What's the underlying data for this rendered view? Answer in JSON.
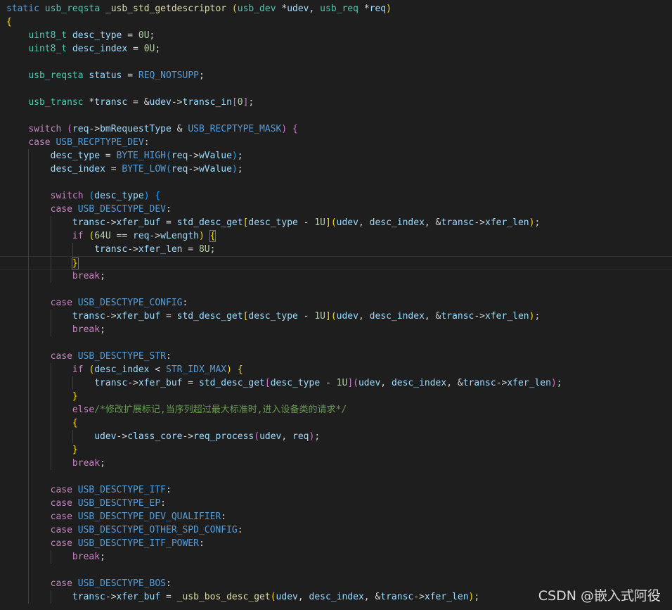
{
  "colors": {
    "background": "#1e1e1e",
    "keyword": "#569cd6",
    "control": "#c586c0",
    "type": "#4ec9b0",
    "function": "#dcdcaa",
    "variable": "#9cdcfe",
    "number": "#b5cea8",
    "comment": "#6a9955",
    "plain": "#d4d4d4",
    "brace1": "#ffd700",
    "brace2": "#da70d6",
    "brace3": "#179fff"
  },
  "code_lines": [
    [
      [
        "static",
        "#569cd6"
      ],
      [
        " ",
        ""
      ],
      [
        "usb_reqsta",
        "#4ec9b0"
      ],
      [
        " ",
        ""
      ],
      [
        "_usb_std_getdescriptor",
        "#dcdcaa"
      ],
      [
        " ",
        ""
      ],
      [
        "(",
        "#ffd700"
      ],
      [
        "usb_dev",
        "#4ec9b0"
      ],
      [
        " *",
        ""
      ],
      [
        "udev",
        "#9cdcfe"
      ],
      [
        ", ",
        ""
      ],
      [
        "usb_req",
        "#4ec9b0"
      ],
      [
        " *",
        ""
      ],
      [
        "req",
        "#9cdcfe"
      ],
      [
        ")",
        "#ffd700"
      ]
    ],
    [
      [
        "{",
        "#ffd700"
      ]
    ],
    [
      [
        "    ",
        ""
      ],
      [
        "uint8_t",
        "#4ec9b0"
      ],
      [
        " ",
        ""
      ],
      [
        "desc_type",
        "#9cdcfe"
      ],
      [
        " = ",
        ""
      ],
      [
        "0U",
        "#b5cea8"
      ],
      [
        ";",
        ""
      ]
    ],
    [
      [
        "    ",
        ""
      ],
      [
        "uint8_t",
        "#4ec9b0"
      ],
      [
        " ",
        ""
      ],
      [
        "desc_index",
        "#9cdcfe"
      ],
      [
        " = ",
        ""
      ],
      [
        "0U",
        "#b5cea8"
      ],
      [
        ";",
        ""
      ]
    ],
    [],
    [
      [
        "    ",
        ""
      ],
      [
        "usb_reqsta",
        "#4ec9b0"
      ],
      [
        " ",
        ""
      ],
      [
        "status",
        "#9cdcfe"
      ],
      [
        " = ",
        ""
      ],
      [
        "REQ_NOTSUPP",
        "#569cd6"
      ],
      [
        ";",
        ""
      ]
    ],
    [],
    [
      [
        "    ",
        ""
      ],
      [
        "usb_transc",
        "#4ec9b0"
      ],
      [
        " *",
        ""
      ],
      [
        "transc",
        "#9cdcfe"
      ],
      [
        " = &",
        ""
      ],
      [
        "udev",
        "#9cdcfe"
      ],
      [
        "->",
        ""
      ],
      [
        "transc_in",
        "#9cdcfe"
      ],
      [
        "[",
        "#da70d6"
      ],
      [
        "0",
        "#b5cea8"
      ],
      [
        "]",
        "#da70d6"
      ],
      [
        ";",
        ""
      ]
    ],
    [],
    [
      [
        "    ",
        ""
      ],
      [
        "switch",
        "#c586c0"
      ],
      [
        " ",
        ""
      ],
      [
        "(",
        "#da70d6"
      ],
      [
        "req",
        "#9cdcfe"
      ],
      [
        "->",
        ""
      ],
      [
        "bmRequestType",
        "#9cdcfe"
      ],
      [
        " & ",
        ""
      ],
      [
        "USB_RECPTYPE_MASK",
        "#569cd6"
      ],
      [
        ")",
        "#da70d6"
      ],
      [
        " ",
        ""
      ],
      [
        "{",
        "#da70d6"
      ]
    ],
    [
      [
        "    ",
        ""
      ],
      [
        "case",
        "#c586c0"
      ],
      [
        " ",
        ""
      ],
      [
        "USB_RECPTYPE_DEV",
        "#569cd6"
      ],
      [
        ":",
        ""
      ]
    ],
    [
      [
        "        ",
        ""
      ],
      [
        "desc_type",
        "#9cdcfe"
      ],
      [
        " = ",
        ""
      ],
      [
        "BYTE_HIGH",
        "#569cd6"
      ],
      [
        "(",
        "#179fff"
      ],
      [
        "req",
        "#9cdcfe"
      ],
      [
        "->",
        ""
      ],
      [
        "wValue",
        "#9cdcfe"
      ],
      [
        ")",
        "#179fff"
      ],
      [
        ";",
        ""
      ]
    ],
    [
      [
        "        ",
        ""
      ],
      [
        "desc_index",
        "#9cdcfe"
      ],
      [
        " = ",
        ""
      ],
      [
        "BYTE_LOW",
        "#569cd6"
      ],
      [
        "(",
        "#179fff"
      ],
      [
        "req",
        "#9cdcfe"
      ],
      [
        "->",
        ""
      ],
      [
        "wValue",
        "#9cdcfe"
      ],
      [
        ")",
        "#179fff"
      ],
      [
        ";",
        ""
      ]
    ],
    [],
    [
      [
        "        ",
        ""
      ],
      [
        "switch",
        "#c586c0"
      ],
      [
        " ",
        ""
      ],
      [
        "(",
        "#179fff"
      ],
      [
        "desc_type",
        "#9cdcfe"
      ],
      [
        ")",
        "#179fff"
      ],
      [
        " ",
        ""
      ],
      [
        "{",
        "#179fff"
      ]
    ],
    [
      [
        "        ",
        ""
      ],
      [
        "case",
        "#c586c0"
      ],
      [
        " ",
        ""
      ],
      [
        "USB_DESCTYPE_DEV",
        "#569cd6"
      ],
      [
        ":",
        ""
      ]
    ],
    [
      [
        "            ",
        ""
      ],
      [
        "transc",
        "#9cdcfe"
      ],
      [
        "->",
        ""
      ],
      [
        "xfer_buf",
        "#9cdcfe"
      ],
      [
        " = ",
        ""
      ],
      [
        "std_desc_get",
        "#9cdcfe"
      ],
      [
        "[",
        "#ffd700"
      ],
      [
        "desc_type",
        "#9cdcfe"
      ],
      [
        " - ",
        ""
      ],
      [
        "1U",
        "#b5cea8"
      ],
      [
        "]",
        "#ffd700"
      ],
      [
        "(",
        "#ffd700"
      ],
      [
        "udev",
        "#9cdcfe"
      ],
      [
        ", ",
        ""
      ],
      [
        "desc_index",
        "#9cdcfe"
      ],
      [
        ", &",
        ""
      ],
      [
        "transc",
        "#9cdcfe"
      ],
      [
        "->",
        ""
      ],
      [
        "xfer_len",
        "#9cdcfe"
      ],
      [
        ")",
        "#ffd700"
      ],
      [
        ";",
        ""
      ]
    ],
    [
      [
        "            ",
        ""
      ],
      [
        "if",
        "#c586c0"
      ],
      [
        " ",
        ""
      ],
      [
        "(",
        "#ffd700"
      ],
      [
        "64U",
        "#b5cea8"
      ],
      [
        " == ",
        ""
      ],
      [
        "req",
        "#9cdcfe"
      ],
      [
        "->",
        ""
      ],
      [
        "wLength",
        "#9cdcfe"
      ],
      [
        ")",
        "#ffd700"
      ],
      [
        " ",
        ""
      ],
      [
        "{",
        "#ffd700",
        "bm"
      ]
    ],
    [
      [
        "                ",
        ""
      ],
      [
        "transc",
        "#9cdcfe"
      ],
      [
        "->",
        ""
      ],
      [
        "xfer_len",
        "#9cdcfe"
      ],
      [
        " = ",
        ""
      ],
      [
        "8U",
        "#b5cea8"
      ],
      [
        ";",
        ""
      ]
    ],
    [
      [
        "            ",
        ""
      ],
      [
        "}",
        "#ffd700",
        "bm"
      ]
    ],
    [
      [
        "            ",
        ""
      ],
      [
        "break",
        "#c586c0"
      ],
      [
        ";",
        ""
      ]
    ],
    [],
    [
      [
        "        ",
        ""
      ],
      [
        "case",
        "#c586c0"
      ],
      [
        " ",
        ""
      ],
      [
        "USB_DESCTYPE_CONFIG",
        "#569cd6"
      ],
      [
        ":",
        ""
      ]
    ],
    [
      [
        "            ",
        ""
      ],
      [
        "transc",
        "#9cdcfe"
      ],
      [
        "->",
        ""
      ],
      [
        "xfer_buf",
        "#9cdcfe"
      ],
      [
        " = ",
        ""
      ],
      [
        "std_desc_get",
        "#9cdcfe"
      ],
      [
        "[",
        "#ffd700"
      ],
      [
        "desc_type",
        "#9cdcfe"
      ],
      [
        " - ",
        ""
      ],
      [
        "1U",
        "#b5cea8"
      ],
      [
        "]",
        "#ffd700"
      ],
      [
        "(",
        "#ffd700"
      ],
      [
        "udev",
        "#9cdcfe"
      ],
      [
        ", ",
        ""
      ],
      [
        "desc_index",
        "#9cdcfe"
      ],
      [
        ", &",
        ""
      ],
      [
        "transc",
        "#9cdcfe"
      ],
      [
        "->",
        ""
      ],
      [
        "xfer_len",
        "#9cdcfe"
      ],
      [
        ")",
        "#ffd700"
      ],
      [
        ";",
        ""
      ]
    ],
    [
      [
        "            ",
        ""
      ],
      [
        "break",
        "#c586c0"
      ],
      [
        ";",
        ""
      ]
    ],
    [],
    [
      [
        "        ",
        ""
      ],
      [
        "case",
        "#c586c0"
      ],
      [
        " ",
        ""
      ],
      [
        "USB_DESCTYPE_STR",
        "#569cd6"
      ],
      [
        ":",
        ""
      ]
    ],
    [
      [
        "            ",
        ""
      ],
      [
        "if",
        "#c586c0"
      ],
      [
        " ",
        ""
      ],
      [
        "(",
        "#ffd700"
      ],
      [
        "desc_index",
        "#9cdcfe"
      ],
      [
        " < ",
        ""
      ],
      [
        "STR_IDX_MAX",
        "#569cd6"
      ],
      [
        ")",
        "#ffd700"
      ],
      [
        " ",
        ""
      ],
      [
        "{",
        "#ffd700"
      ]
    ],
    [
      [
        "                ",
        ""
      ],
      [
        "transc",
        "#9cdcfe"
      ],
      [
        "->",
        ""
      ],
      [
        "xfer_buf",
        "#9cdcfe"
      ],
      [
        " = ",
        ""
      ],
      [
        "std_desc_get",
        "#9cdcfe"
      ],
      [
        "[",
        "#da70d6"
      ],
      [
        "desc_type",
        "#9cdcfe"
      ],
      [
        " - ",
        ""
      ],
      [
        "1U",
        "#b5cea8"
      ],
      [
        "]",
        "#da70d6"
      ],
      [
        "(",
        "#da70d6"
      ],
      [
        "udev",
        "#9cdcfe"
      ],
      [
        ", ",
        ""
      ],
      [
        "desc_index",
        "#9cdcfe"
      ],
      [
        ", &",
        ""
      ],
      [
        "transc",
        "#9cdcfe"
      ],
      [
        "->",
        ""
      ],
      [
        "xfer_len",
        "#9cdcfe"
      ],
      [
        ")",
        "#da70d6"
      ],
      [
        ";",
        ""
      ]
    ],
    [
      [
        "            ",
        ""
      ],
      [
        "}",
        "#ffd700"
      ]
    ],
    [
      [
        "            ",
        ""
      ],
      [
        "else",
        "#c586c0"
      ],
      [
        "/*修改扩展标记,当序列超过最大标准时,进入设备类的请求*/",
        "#6a9955"
      ]
    ],
    [
      [
        "            ",
        ""
      ],
      [
        "{",
        "#ffd700"
      ]
    ],
    [
      [
        "                ",
        ""
      ],
      [
        "udev",
        "#9cdcfe"
      ],
      [
        "->",
        ""
      ],
      [
        "class_core",
        "#9cdcfe"
      ],
      [
        "->",
        ""
      ],
      [
        "req_process",
        "#9cdcfe"
      ],
      [
        "(",
        "#da70d6"
      ],
      [
        "udev",
        "#9cdcfe"
      ],
      [
        ", ",
        ""
      ],
      [
        "req",
        "#9cdcfe"
      ],
      [
        ")",
        "#da70d6"
      ],
      [
        ";",
        ""
      ]
    ],
    [
      [
        "            ",
        ""
      ],
      [
        "}",
        "#ffd700"
      ]
    ],
    [
      [
        "            ",
        ""
      ],
      [
        "break",
        "#c586c0"
      ],
      [
        ";",
        ""
      ]
    ],
    [],
    [
      [
        "        ",
        ""
      ],
      [
        "case",
        "#c586c0"
      ],
      [
        " ",
        ""
      ],
      [
        "USB_DESCTYPE_ITF",
        "#569cd6"
      ],
      [
        ":",
        ""
      ]
    ],
    [
      [
        "        ",
        ""
      ],
      [
        "case",
        "#c586c0"
      ],
      [
        " ",
        ""
      ],
      [
        "USB_DESCTYPE_EP",
        "#569cd6"
      ],
      [
        ":",
        ""
      ]
    ],
    [
      [
        "        ",
        ""
      ],
      [
        "case",
        "#c586c0"
      ],
      [
        " ",
        ""
      ],
      [
        "USB_DESCTYPE_DEV_QUALIFIER",
        "#569cd6"
      ],
      [
        ":",
        ""
      ]
    ],
    [
      [
        "        ",
        ""
      ],
      [
        "case",
        "#c586c0"
      ],
      [
        " ",
        ""
      ],
      [
        "USB_DESCTYPE_OTHER_SPD_CONFIG",
        "#569cd6"
      ],
      [
        ":",
        ""
      ]
    ],
    [
      [
        "        ",
        ""
      ],
      [
        "case",
        "#c586c0"
      ],
      [
        " ",
        ""
      ],
      [
        "USB_DESCTYPE_ITF_POWER",
        "#569cd6"
      ],
      [
        ":",
        ""
      ]
    ],
    [
      [
        "            ",
        ""
      ],
      [
        "break",
        "#c586c0"
      ],
      [
        ";",
        ""
      ]
    ],
    [],
    [
      [
        "        ",
        ""
      ],
      [
        "case",
        "#c586c0"
      ],
      [
        " ",
        ""
      ],
      [
        "USB_DESCTYPE_BOS",
        "#569cd6"
      ],
      [
        ":",
        ""
      ]
    ],
    [
      [
        "            ",
        ""
      ],
      [
        "transc",
        "#9cdcfe"
      ],
      [
        "->",
        ""
      ],
      [
        "xfer_buf",
        "#9cdcfe"
      ],
      [
        " = ",
        ""
      ],
      [
        "_usb_bos_desc_get",
        "#dcdcaa"
      ],
      [
        "(",
        "#ffd700"
      ],
      [
        "udev",
        "#9cdcfe"
      ],
      [
        ", ",
        ""
      ],
      [
        "desc_index",
        "#9cdcfe"
      ],
      [
        ", &",
        ""
      ],
      [
        "transc",
        "#9cdcfe"
      ],
      [
        "->",
        ""
      ],
      [
        "xfer_len",
        "#9cdcfe"
      ],
      [
        ")",
        "#ffd700"
      ],
      [
        ";",
        ""
      ]
    ]
  ],
  "watermark": "CSDN @嵌入式阿役"
}
